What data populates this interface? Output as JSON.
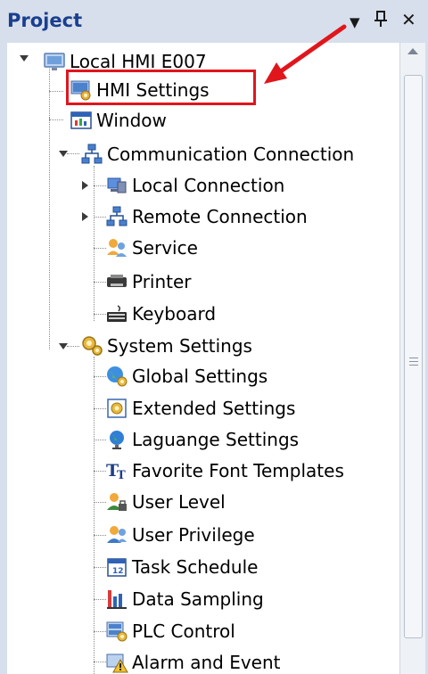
{
  "panel": {
    "title": "Project",
    "header_buttons": {
      "dropdown": "▼",
      "pin": "ꟷ",
      "close": "✕"
    }
  },
  "tree": {
    "root": {
      "label": "Local HMI E007",
      "icon": "monitor-icon"
    },
    "items": [
      {
        "label": "HMI Settings",
        "icon": "hmi-settings-icon",
        "highlighted": true
      },
      {
        "label": "Window",
        "icon": "window-icon"
      },
      {
        "label": "Communication Connection",
        "icon": "network-icon",
        "expanded": true,
        "children": [
          {
            "label": "Local Connection",
            "icon": "local-connection-icon",
            "collapsed": true
          },
          {
            "label": "Remote Connection",
            "icon": "network-icon",
            "collapsed": true
          },
          {
            "label": "Service",
            "icon": "service-icon"
          },
          {
            "label": "Printer",
            "icon": "printer-icon"
          },
          {
            "label": "Keyboard",
            "icon": "keyboard-icon"
          }
        ]
      },
      {
        "label": "System Settings",
        "icon": "system-settings-icon",
        "expanded": true,
        "children": [
          {
            "label": "Global Settings",
            "icon": "globe-gear-icon"
          },
          {
            "label": "Extended Settings",
            "icon": "extended-settings-icon"
          },
          {
            "label": "Laguange Settings",
            "icon": "language-globe-icon"
          },
          {
            "label": "Favorite Font Templates",
            "icon": "font-icon"
          },
          {
            "label": "User Level",
            "icon": "user-level-icon"
          },
          {
            "label": "User Privilege",
            "icon": "user-privilege-icon"
          },
          {
            "label": "Task Schedule",
            "icon": "calendar-icon"
          },
          {
            "label": "Data Sampling",
            "icon": "bar-chart-icon"
          },
          {
            "label": "PLC Control",
            "icon": "plc-control-icon"
          },
          {
            "label": "Alarm and Event",
            "icon": "alarm-icon"
          }
        ]
      }
    ]
  },
  "colors": {
    "highlight": "#e0161c",
    "title": "#1a3f8f"
  }
}
